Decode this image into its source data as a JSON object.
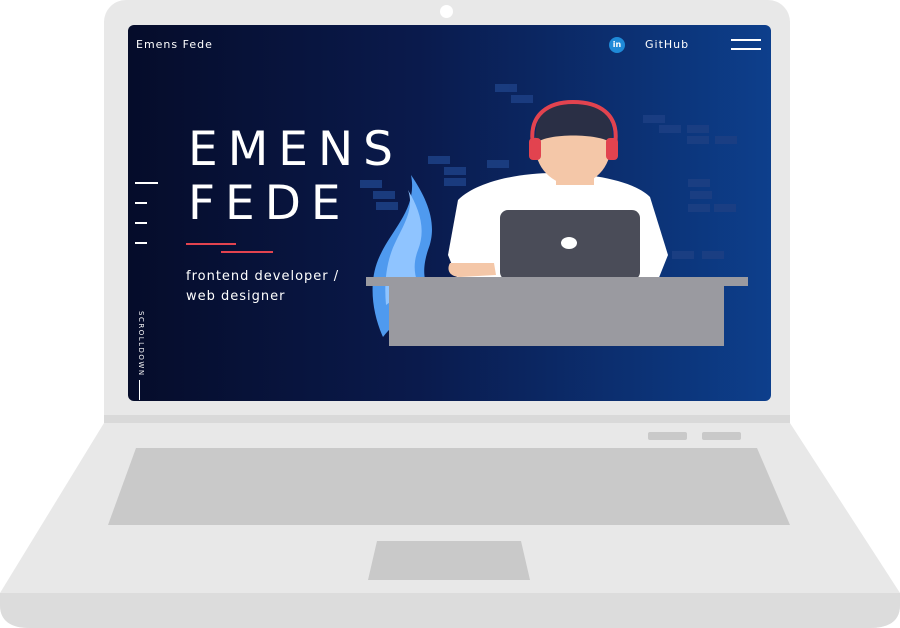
{
  "header": {
    "brand": "Emens Fede",
    "linkedin_icon": "in",
    "github": "GitHub"
  },
  "hero": {
    "title_line1": "EMENS",
    "title_line2": "FEDE",
    "subtitle_line1": "frontend developer /",
    "subtitle_line2": "web designer",
    "scroll": "SCROLLDOWN"
  },
  "colors": {
    "accent": "#e2434f",
    "bg_dark": "#050c2a",
    "bg_light": "#0d3f8c",
    "flame": "#5ba4f2"
  },
  "icons": [
    "linkedin-icon",
    "menu-icon",
    "developer-illustration"
  ]
}
